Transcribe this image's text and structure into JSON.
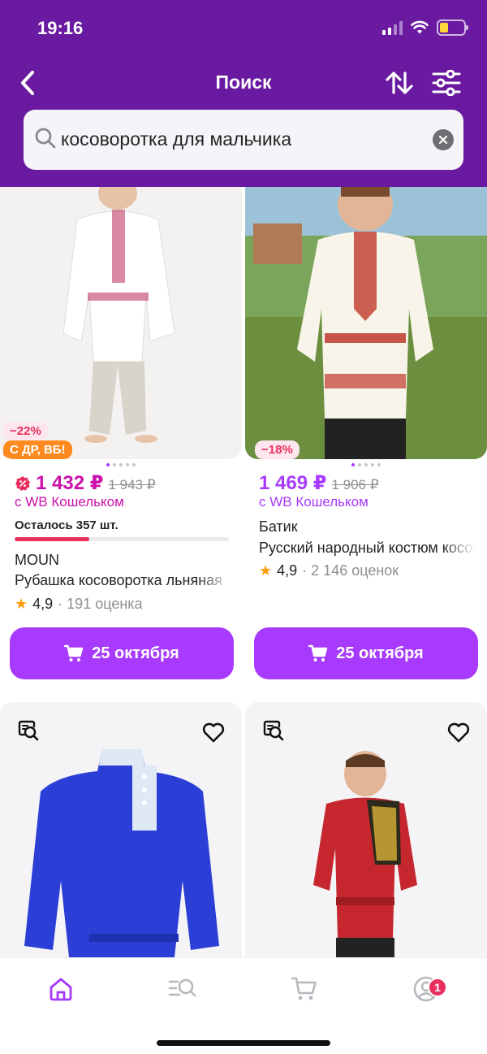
{
  "status_bar": {
    "time": "19:16"
  },
  "header": {
    "title": "Поиск"
  },
  "search": {
    "query": "косоворотка для мальчика"
  },
  "products": [
    {
      "discount_badge": "−22%",
      "promo_badge": "С ДР, ВБ!",
      "price": "1 432 ₽",
      "old_price": "1 943 ₽",
      "wallet_note": "с WB Кошельком",
      "stock_text": "Осталось 357 шт.",
      "stock_level": 0.35,
      "brand": "MOUN",
      "name": "Рубашка косоворотка льняная",
      "rating": "4,9",
      "reviews": "· 191 оценка",
      "delivery_label": "25 октября",
      "price_color": "#cb11ab"
    },
    {
      "discount_badge": "−18%",
      "price": "1 469 ₽",
      "old_price": "1 906 ₽",
      "wallet_note": "с WB Кошельком",
      "brand": "Батик",
      "name": "Русский народный костюм косоворотка",
      "rating": "4,9",
      "reviews": "· 2 146 оценок",
      "delivery_label": "25 октября",
      "price_color": "#a73afd"
    }
  ],
  "tabbar": {
    "profile_badge": "1"
  },
  "colors": {
    "header_bg": "#6a1aa0",
    "accent": "#a73afd",
    "price_accent": "#cb11ab",
    "sale": "#e8305f"
  }
}
